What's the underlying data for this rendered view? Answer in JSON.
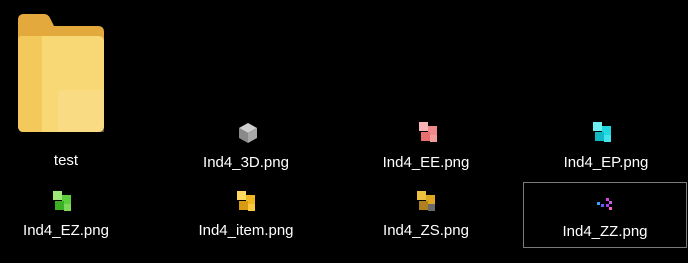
{
  "window": {
    "background": "#000000"
  },
  "files": [
    {
      "name": "test",
      "type": "folder",
      "icon": "folder-icon",
      "color": "#f5c75c"
    },
    {
      "name": "Ind4_3D.png",
      "type": "png",
      "icon": "cube-gray-icon",
      "color": "#9a9a9a"
    },
    {
      "name": "Ind4_EE.png",
      "type": "png",
      "icon": "cubes-pink-icon",
      "color": "#f08a8a"
    },
    {
      "name": "Ind4_EP.png",
      "type": "png",
      "icon": "cubes-cyan-icon",
      "color": "#20d8e0"
    },
    {
      "name": "Ind4_EZ.png",
      "type": "png",
      "icon": "cubes-green-icon",
      "color": "#5cd03c"
    },
    {
      "name": "Ind4_item.png",
      "type": "png",
      "icon": "cubes-yellow-icon",
      "color": "#f0b820"
    },
    {
      "name": "Ind4_ZS.png",
      "type": "png",
      "icon": "cubes-yellow-dark-icon",
      "color": "#e0a820"
    },
    {
      "name": "Ind4_ZZ.png",
      "type": "png",
      "icon": "dots-multicolor-icon",
      "color": "#c060e0",
      "selected": true
    }
  ]
}
